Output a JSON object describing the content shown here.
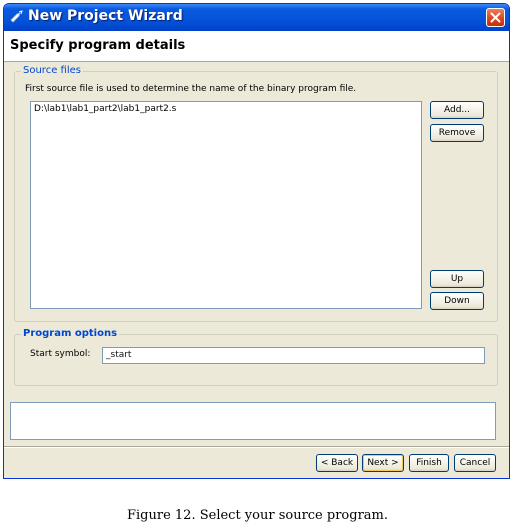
{
  "window": {
    "title": "New Project Wizard",
    "heading": "Specify program details"
  },
  "source_files": {
    "legend": "Source files",
    "description": "First source file is used to determine the name of the binary program file.",
    "files": [
      "D:\\lab1\\lab1_part2\\lab1_part2.s"
    ],
    "add_label": "Add...",
    "remove_label": "Remove",
    "up_label": "Up",
    "down_label": "Down"
  },
  "program_options": {
    "legend": "Program options",
    "start_symbol_label": "Start symbol:",
    "start_symbol_value": "_start"
  },
  "footer": {
    "back_label": "< Back",
    "next_label": "Next >",
    "finish_label": "Finish",
    "cancel_label": "Cancel"
  },
  "caption": "Figure 12. Select your source program.",
  "colors": {
    "titlebar": "#0453d9",
    "legend": "#0046d5",
    "face": "#ece9d8"
  },
  "icons": {
    "title": "wizard-icon",
    "close": "close-icon"
  }
}
